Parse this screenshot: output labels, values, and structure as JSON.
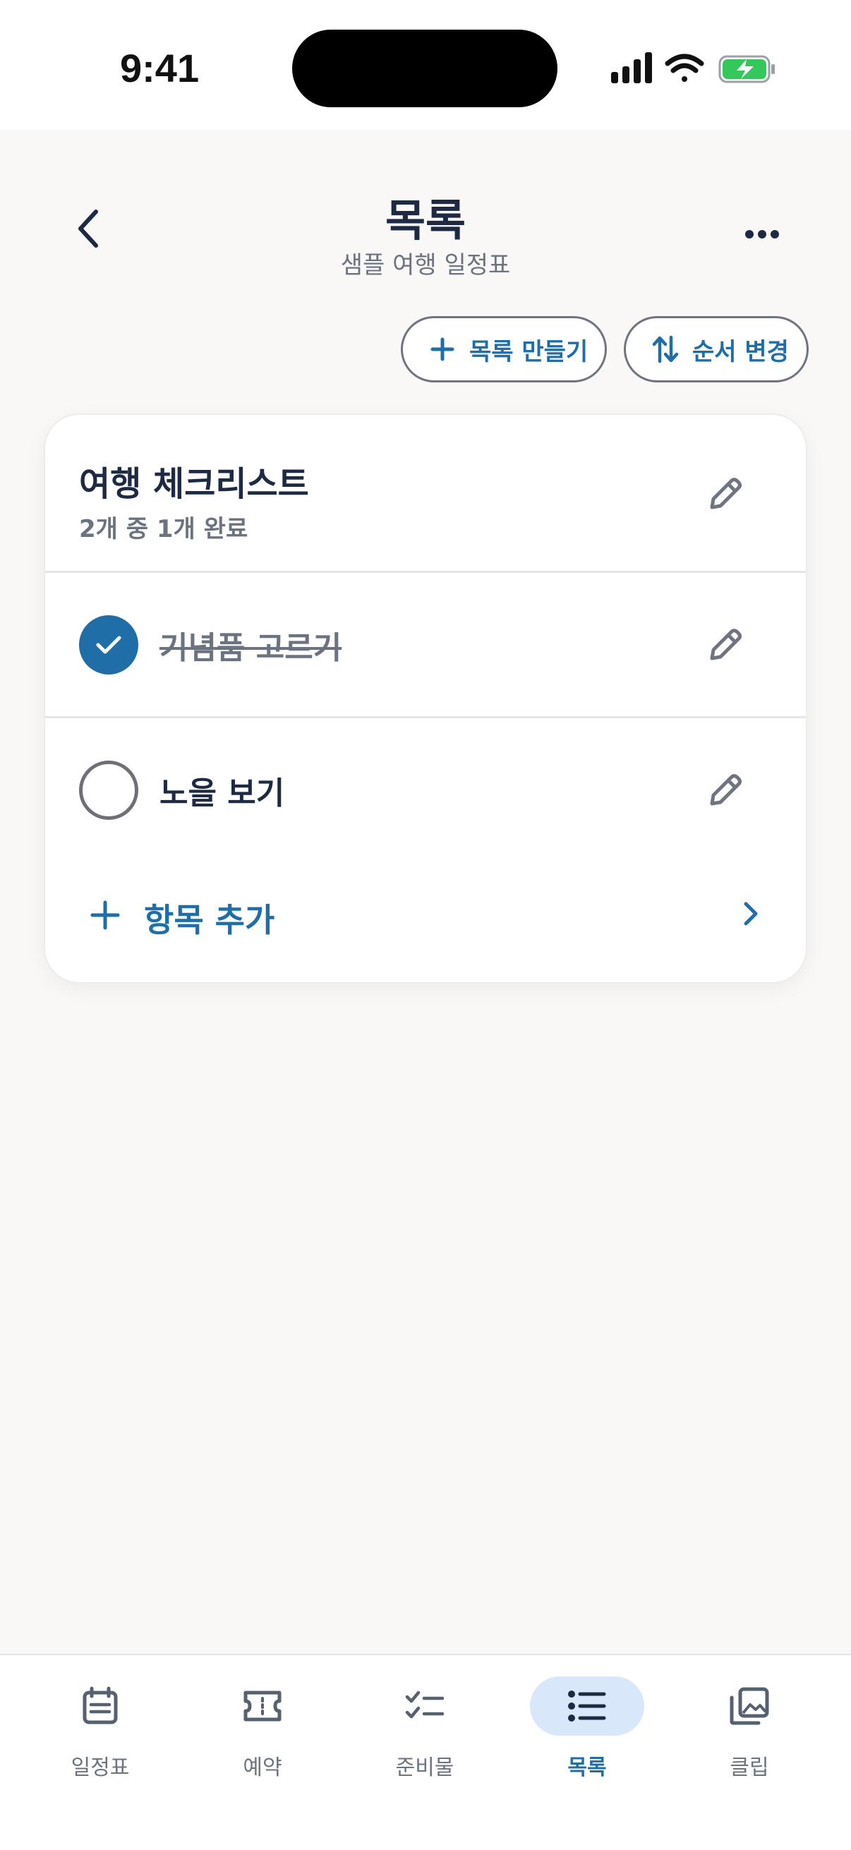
{
  "status_bar": {
    "time": "9:41",
    "icons": [
      "signal-icon",
      "wifi-icon",
      "battery-charging-icon"
    ]
  },
  "header": {
    "title": "목록",
    "subtitle": "샘플 여행 일정표",
    "back_icon": "chevron-left-icon",
    "more_icon": "more-horizontal-icon"
  },
  "actions": {
    "create_label": "목록 만들기",
    "reorder_label": "순서 변경"
  },
  "list": {
    "title": "여행 체크리스트",
    "progress": "2개 중 1개 완료",
    "items": [
      {
        "label": "기념품 고르기",
        "done": true
      },
      {
        "label": "노을 보기",
        "done": false
      }
    ],
    "add_label": "항목 추가"
  },
  "tabs": [
    {
      "label": "일정표",
      "icon": "calendar-icon",
      "active": false
    },
    {
      "label": "예약",
      "icon": "ticket-icon",
      "active": false
    },
    {
      "label": "준비물",
      "icon": "checklist-icon",
      "active": false
    },
    {
      "label": "목록",
      "icon": "list-icon",
      "active": true
    },
    {
      "label": "클립",
      "icon": "gallery-icon",
      "active": false
    }
  ],
  "colors": {
    "accent": "#1f6ea8",
    "active_tab_bg": "#d8e8fa",
    "text_dark": "#1e2a44",
    "text_muted": "#6b7280",
    "background": "#f9f8f6"
  }
}
